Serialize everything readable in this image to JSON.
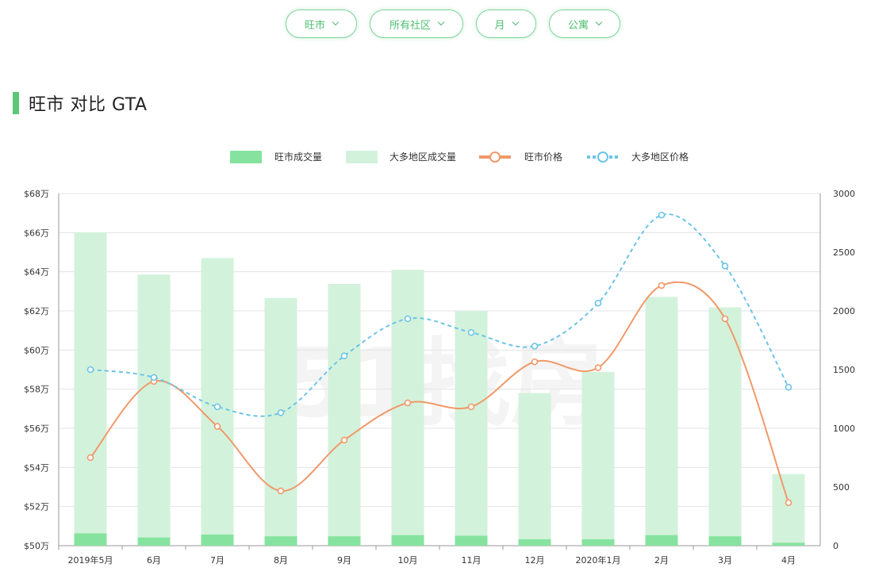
{
  "filters": [
    {
      "label": "旺市"
    },
    {
      "label": "所有社区"
    },
    {
      "label": "月"
    },
    {
      "label": "公寓"
    }
  ],
  "section": {
    "title": "旺市 对比 GTA"
  },
  "watermark": "51找房",
  "colors": {
    "accent": "#5cc777",
    "local_volume": "#86e39f",
    "gta_volume": "#d3f2db",
    "local_price": "#f0996a",
    "gta_price": "#6cc4e8"
  },
  "chart_data": {
    "type": "bar",
    "categories": [
      "2019年5月",
      "6月",
      "7月",
      "8月",
      "9月",
      "10月",
      "11月",
      "12月",
      "2020年1月",
      "2月",
      "3月",
      "4月"
    ],
    "series": [
      {
        "name": "旺市成交量",
        "type": "bar",
        "axis": "right",
        "values": [
          105,
          70,
          95,
          80,
          80,
          90,
          85,
          55,
          55,
          90,
          80,
          25
        ]
      },
      {
        "name": "大多地区成交量",
        "type": "bar",
        "axis": "right",
        "values": [
          2670,
          2310,
          2450,
          2110,
          2230,
          2350,
          2000,
          1300,
          1480,
          2120,
          2030,
          610
        ]
      },
      {
        "name": "旺市价格",
        "type": "line",
        "axis": "left",
        "style": "solid",
        "values": [
          54.5,
          58.4,
          56.1,
          52.8,
          55.4,
          57.3,
          57.1,
          59.4,
          59.1,
          63.3,
          61.6,
          52.2
        ]
      },
      {
        "name": "大多地区价格",
        "type": "line",
        "axis": "left",
        "style": "dashed",
        "values": [
          59.0,
          58.6,
          57.1,
          56.8,
          59.7,
          61.6,
          60.9,
          60.2,
          62.4,
          66.9,
          64.3,
          58.1
        ]
      }
    ],
    "y_left": {
      "ticks": [
        "$50万",
        "$52万",
        "$54万",
        "$56万",
        "$58万",
        "$60万",
        "$62万",
        "$64万",
        "$66万",
        "$68万"
      ],
      "min": 50,
      "max": 68
    },
    "y_right": {
      "ticks": [
        "0",
        "500",
        "1000",
        "1500",
        "2000",
        "2500",
        "3000"
      ],
      "min": 0,
      "max": 3000
    },
    "legend_position": "top-center",
    "grid": true
  }
}
